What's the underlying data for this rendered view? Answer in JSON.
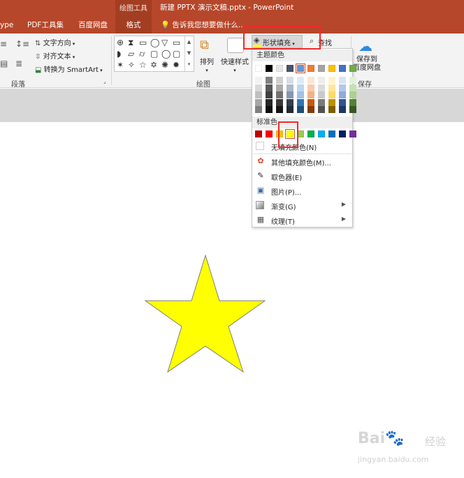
{
  "app": {
    "doc_title": "新建 PPTX 演示文稿.pptx - PowerPoint",
    "context_group": "绘图工具"
  },
  "tabs": [
    {
      "label": "ype"
    },
    {
      "label": "PDF工具集"
    },
    {
      "label": "百度网盘"
    },
    {
      "label": "格式"
    }
  ],
  "tellme": "告诉我您想要做什么...",
  "ribbon": {
    "text_direction": "文字方向",
    "align_text": "对齐文本",
    "convert_smartart": "转换为 SmartArt",
    "paragraph_group": "段落",
    "arrange": "排列",
    "quick_styles": "快速样式",
    "drawing_group": "绘图",
    "shape_fill": "形状填充",
    "find": "查找",
    "save_to_line1": "保存到",
    "save_to_line2": "百度网盘",
    "save_group": "保存"
  },
  "fill_menu": {
    "theme_colors_header": "主题颜色",
    "standard_colors_header": "标准色",
    "theme_colors": [
      "#ffffff",
      "#000000",
      "#e7e6e6",
      "#44546a",
      "#5b9bd5",
      "#ed7d31",
      "#a5a5a5",
      "#ffc000",
      "#4472c4",
      "#70ad47"
    ],
    "theme_shades": [
      [
        "#f2f2f2",
        "#d9d9d9",
        "#bfbfbf",
        "#a6a6a6",
        "#808080"
      ],
      [
        "#808080",
        "#595959",
        "#404040",
        "#262626",
        "#0d0d0d"
      ],
      [
        "#d0cece",
        "#aeaaaa",
        "#757171",
        "#3a3838",
        "#171616"
      ],
      [
        "#d6dce5",
        "#adb9ca",
        "#8497b0",
        "#333f50",
        "#222a35"
      ],
      [
        "#deebf7",
        "#bdd7ee",
        "#9dc3e6",
        "#2e75b6",
        "#1f4e79"
      ],
      [
        "#fbe5d6",
        "#f8cbad",
        "#f4b183",
        "#c55a11",
        "#843c0c"
      ],
      [
        "#ededed",
        "#dbdbdb",
        "#c9c9c9",
        "#7b7b7b",
        "#525252"
      ],
      [
        "#fff2cc",
        "#ffe699",
        "#ffd966",
        "#bf9000",
        "#7f6000"
      ],
      [
        "#dae3f3",
        "#b4c7e7",
        "#8faadc",
        "#2f5597",
        "#203864"
      ],
      [
        "#e2f0d9",
        "#c5e0b4",
        "#a9d18e",
        "#548235",
        "#385723"
      ]
    ],
    "standard_colors": [
      "#c00000",
      "#ff0000",
      "#ffc000",
      "#ffff00",
      "#92d050",
      "#00b050",
      "#00b0f0",
      "#0070c0",
      "#002060",
      "#7030a0"
    ],
    "selected_standard": "#ffff00",
    "no_fill": "无填充颜色(N)",
    "more_colors": "其他填充颜色(M)...",
    "eyedropper": "取色器(E)",
    "picture": "图片(P)...",
    "gradient": "渐变(G)",
    "texture": "纹理(T)"
  },
  "slide": {
    "star_fill": "#ffff00",
    "star_stroke": "#7f7f7f"
  },
  "watermark": {
    "logo": "Bai",
    "text": "经验",
    "url": "jingyan.baidu.com"
  },
  "colors": {
    "accent": "#b7472a",
    "highlight": "#f02a2a"
  }
}
